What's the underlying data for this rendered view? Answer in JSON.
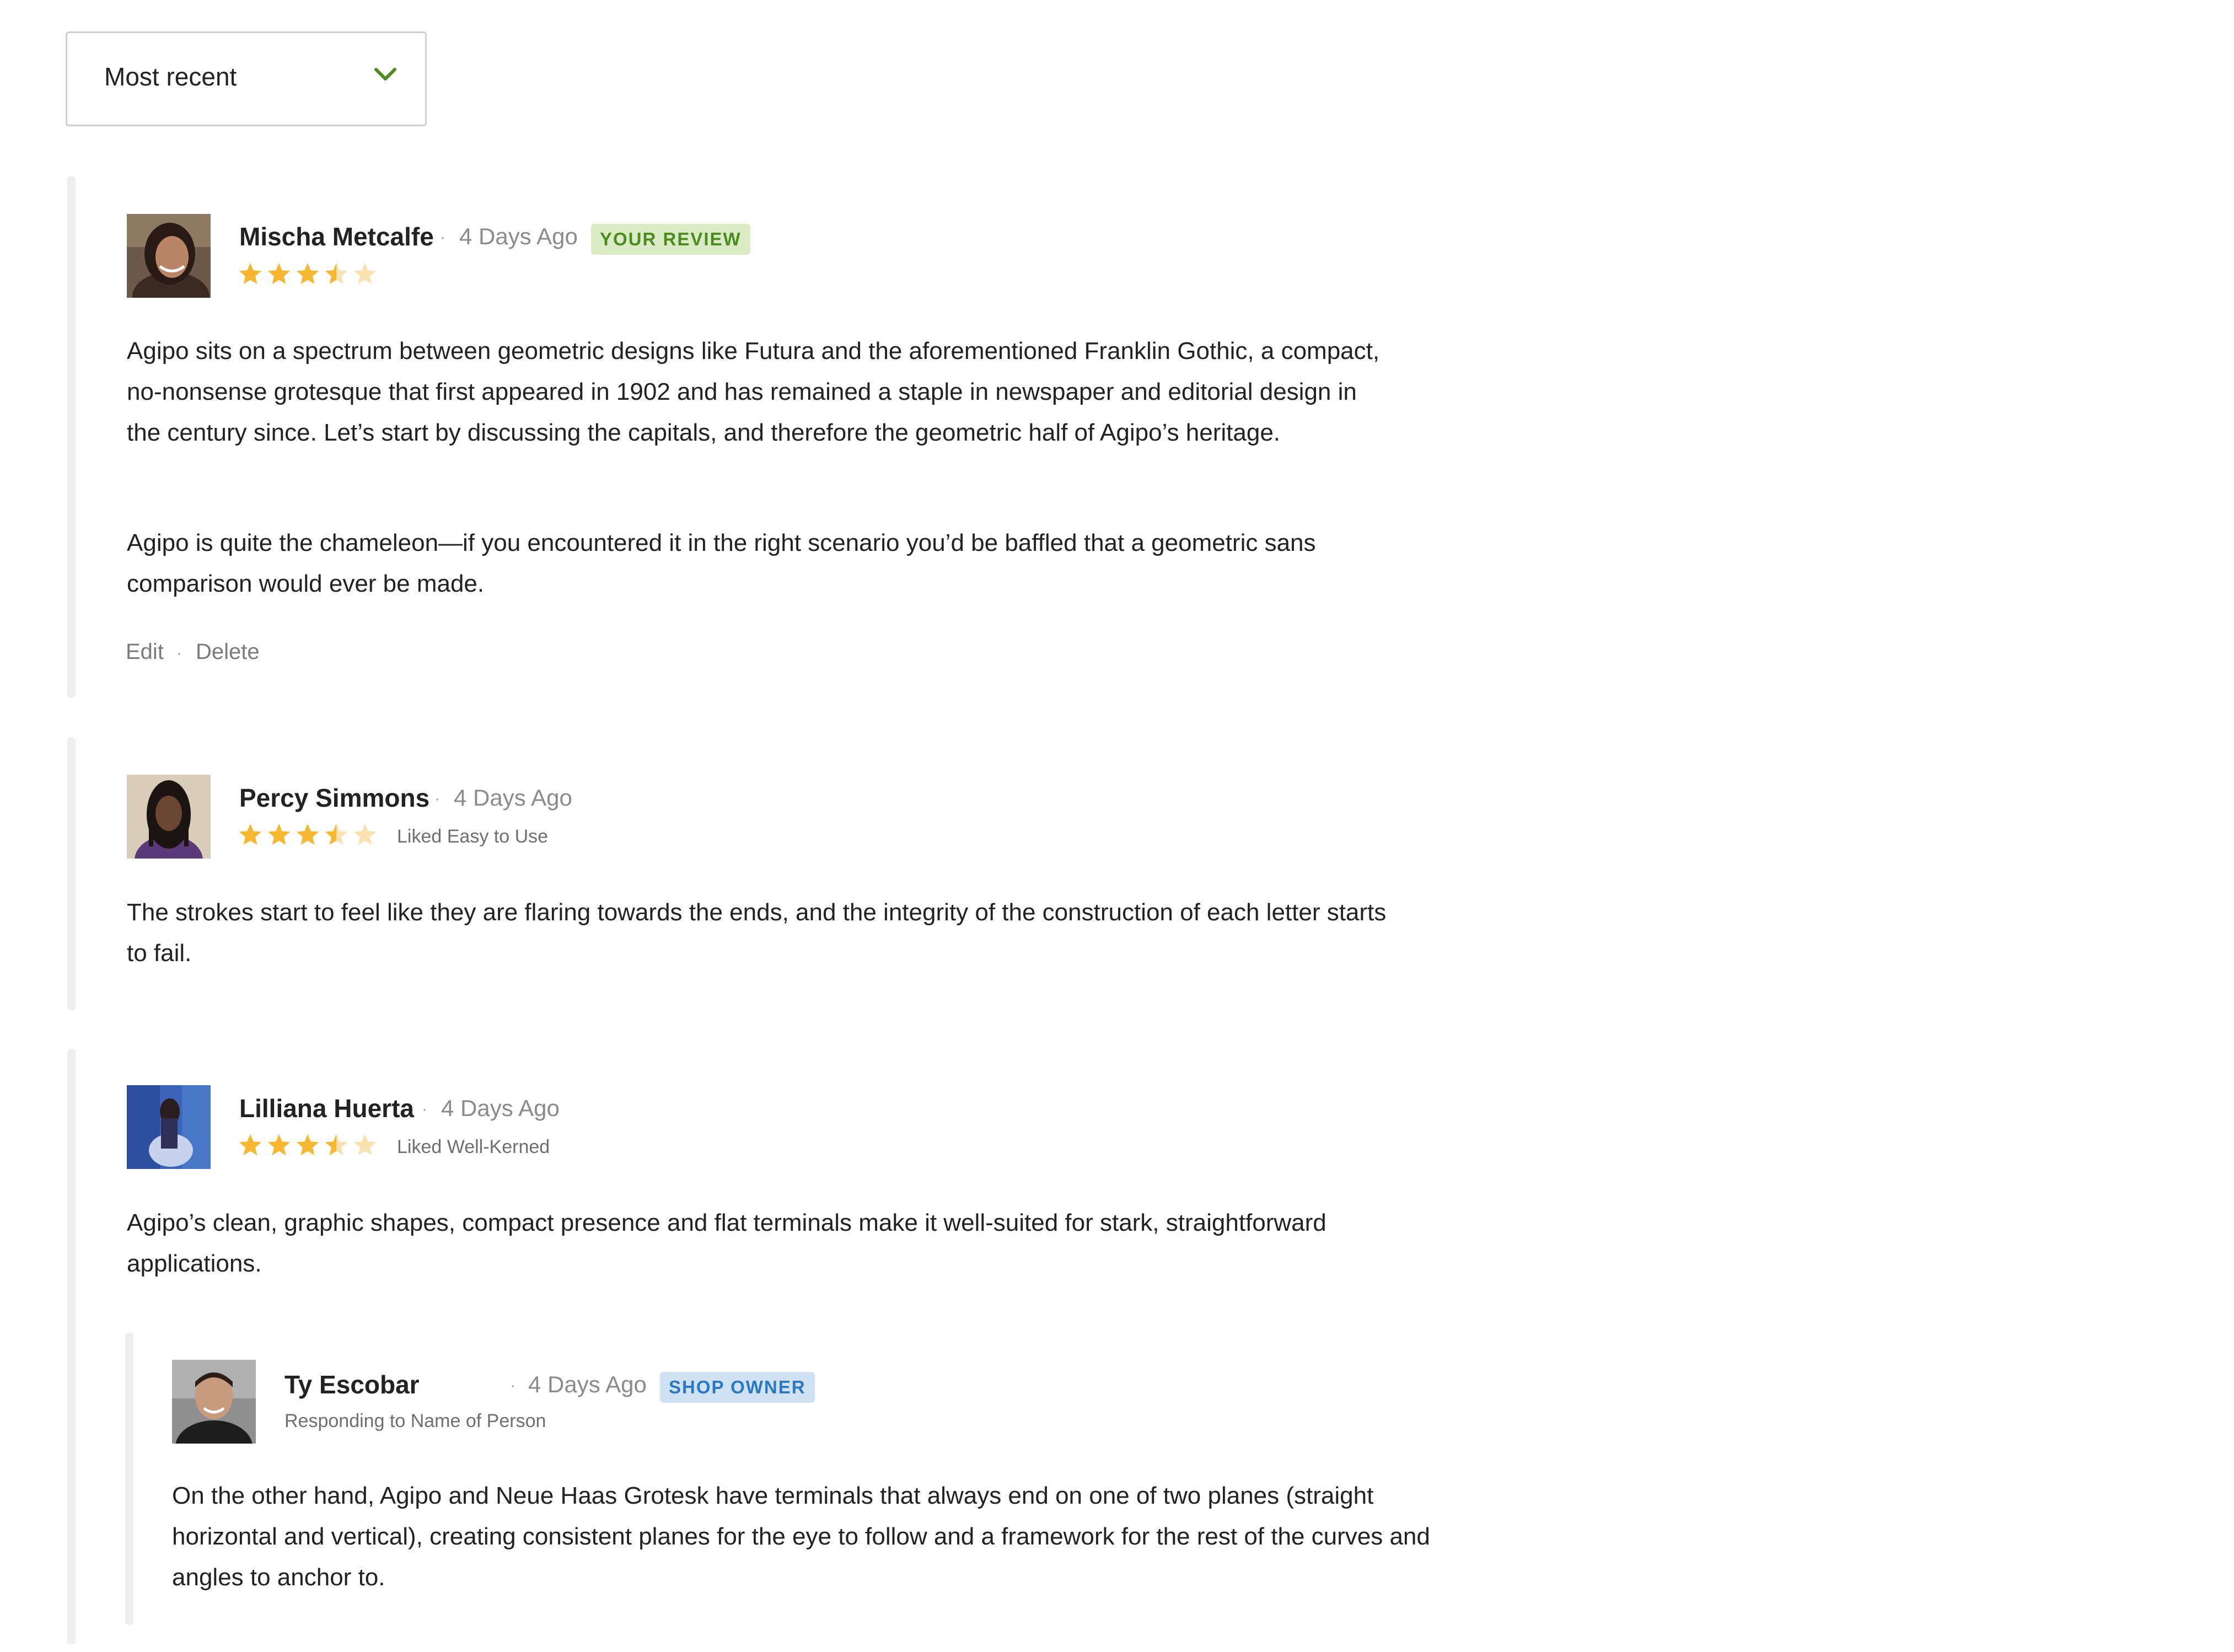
{
  "sort": {
    "label": "Most recent",
    "icon": "chevron-down-icon"
  },
  "colors": {
    "accent_green": "#4c8b1f",
    "star_filled": "#f7b731",
    "star_empty": "#f9e2b0",
    "badge_green_bg": "#d9ecc6",
    "badge_blue_bg": "#cfe2f4",
    "badge_blue_text": "#2b78c2",
    "rail": "#eeeeee"
  },
  "reviews": [
    {
      "name": "Mischa Metcalfe",
      "date": "4 Days Ago",
      "badge": "YOUR REVIEW",
      "rating": 3.5,
      "paragraphs": [
        "Agipo sits on a spectrum between geometric designs like Futura and the aforementioned Franklin Gothic, a compact, no-nonsense grotesque that first appeared in 1902 and has remained a staple in newspaper and editorial design in the century since. Let’s start by discussing the capitals, and therefore the geometric half of Agipo’s heritage.",
        "Agipo is quite the chameleon—if you encountered it in the right scenario you’d be baffled that a geometric sans comparison would ever be made."
      ],
      "actions": {
        "edit": "Edit",
        "delete": "Delete"
      }
    },
    {
      "name": "Percy Simmons",
      "date": "4 Days Ago",
      "rating": 3.5,
      "liked": "Liked Easy to Use",
      "paragraphs": [
        "The strokes start to feel like they are flaring towards the ends, and the integrity of the construction of each letter starts to fail."
      ]
    },
    {
      "name": "Lilliana Huerta",
      "date": "4 Days Ago",
      "rating": 3.5,
      "liked": "Liked Well-Kerned",
      "paragraphs": [
        "Agipo’s clean, graphic shapes, compact presence and flat terminals make it well-suited for stark, straightforward applications."
      ],
      "reply": {
        "name": "Ty Escobar",
        "date": "4 Days Ago",
        "badge": "SHOP OWNER",
        "responding": "Responding to Name of Person",
        "paragraphs": [
          "On the other hand, Agipo and Neue Haas Grotesk have terminals that always end on one of two planes (straight horizontal and vertical), creating consistent planes for the eye to follow and a framework for the rest of the curves and angles to anchor to."
        ]
      }
    }
  ]
}
